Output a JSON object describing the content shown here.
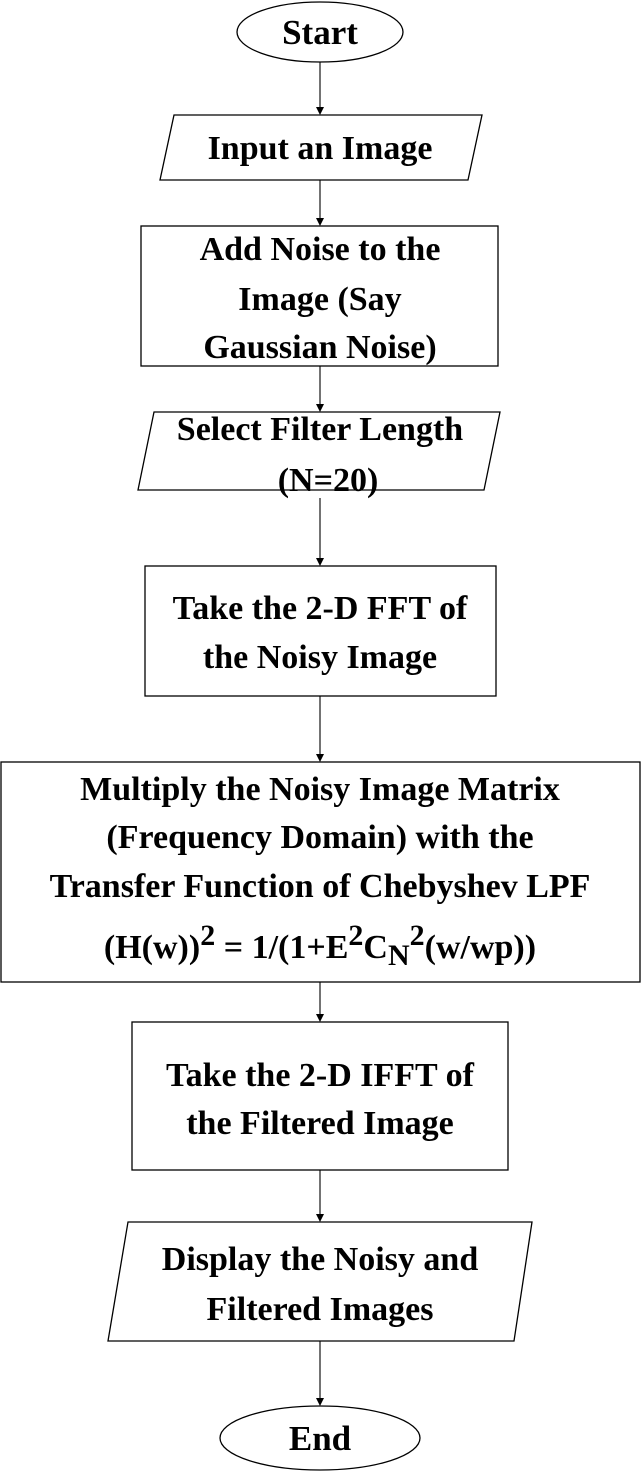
{
  "nodes": {
    "start": {
      "label": "Start"
    },
    "input_image": {
      "label": "Input an Image"
    },
    "add_noise": {
      "lines": [
        "Add Noise to the",
        "Image (Say",
        "Gaussian Noise)"
      ]
    },
    "filter_length": {
      "lines": [
        "Select Filter Length",
        "(N=20)"
      ]
    },
    "fft": {
      "lines": [
        "Take the 2-D FFT of",
        "the Noisy Image"
      ]
    },
    "multiply": {
      "lines": [
        "Multiply the Noisy Image Matrix",
        "(Frequency Domain) with the",
        "Transfer Function of Chebyshev LPF"
      ],
      "formula": {
        "part1": "(H(w))",
        "sup1": "2",
        "part2": " = 1/(1+E",
        "sup2": "2",
        "part3": "C",
        "sub1": "N",
        "sup3": "2",
        "part4": "(w/wp))"
      }
    },
    "ifft": {
      "lines": [
        "Take the 2-D IFFT of",
        "the Filtered Image"
      ]
    },
    "display": {
      "lines": [
        "Display the Noisy and",
        "Filtered Images"
      ]
    },
    "end": {
      "label": "End"
    }
  }
}
